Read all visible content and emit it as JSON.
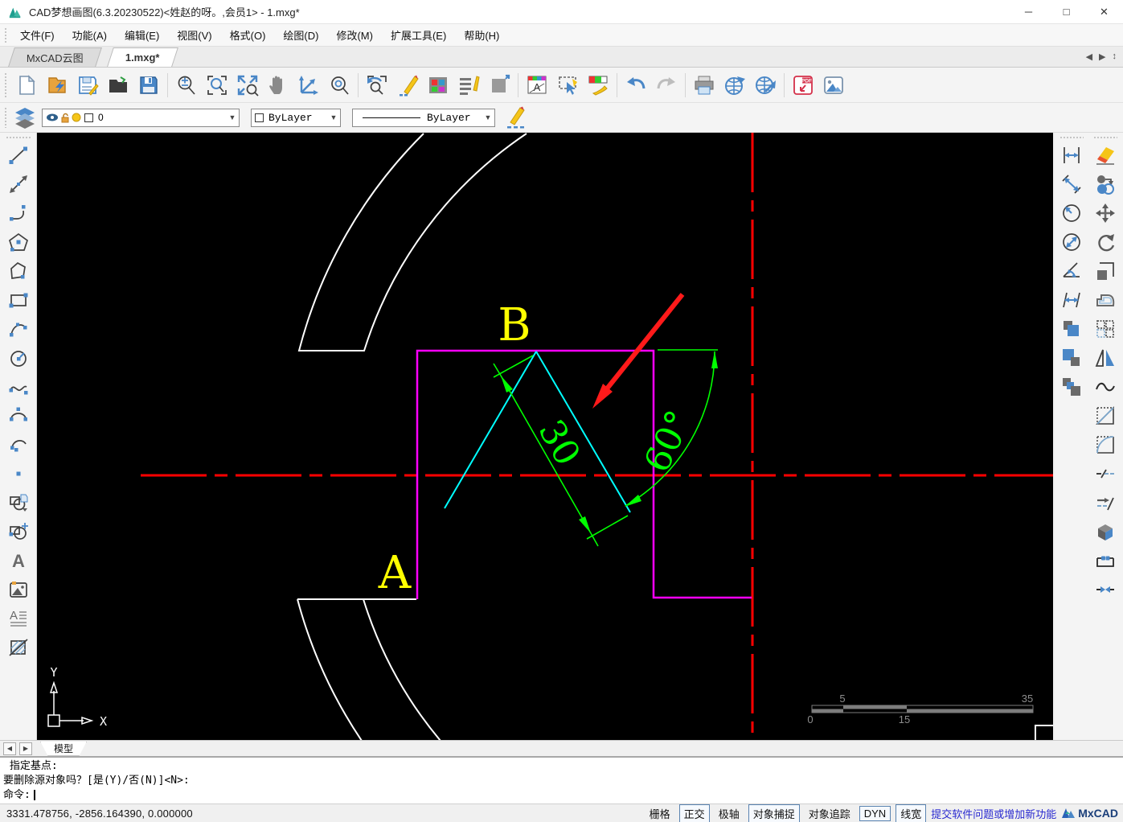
{
  "window": {
    "title": "CAD梦想画图(6.3.20230522)<姓赵的呀。,会员1> - 1.mxg*",
    "controls": {
      "minimize": "─",
      "maximize": "□",
      "close": "✕"
    }
  },
  "menu": {
    "items": [
      "文件(F)",
      "功能(A)",
      "编辑(E)",
      "视图(V)",
      "格式(O)",
      "绘图(D)",
      "修改(M)",
      "扩展工具(E)",
      "帮助(H)"
    ]
  },
  "doc_tabs": {
    "items": [
      {
        "label": "MxCAD云图"
      },
      {
        "label": "1.mxg*"
      }
    ],
    "scrollers": [
      "◀",
      "▶",
      "↕"
    ]
  },
  "toolbar": {
    "icons": [
      "new-file",
      "open-import",
      "save",
      "open-folder",
      "save-as",
      "zoom-scale",
      "zoom-window",
      "zoom-extents",
      "pan",
      "ucs-axes",
      "zoom-center",
      "zoom-previous",
      "sketch-pencil",
      "color-palette",
      "text-style",
      "page-setup",
      "layer-manager",
      "quick-select",
      "match-properties",
      "undo",
      "redo",
      "print",
      "publish-web",
      "web-upload",
      "export-pdf",
      "export-image"
    ]
  },
  "properties_bar": {
    "layer": {
      "value": "0"
    },
    "color": {
      "value": "ByLayer"
    },
    "linetype": {
      "value": "ByLayer"
    }
  },
  "left_toolbar": {
    "icons": [
      "line",
      "construction-line",
      "polyline",
      "polygon-filled",
      "polygon",
      "rectangle",
      "arc",
      "circle",
      "spline",
      "ellipse",
      "ellipse-arc",
      "point",
      "insert-block",
      "create-block",
      "text",
      "image",
      "mtext",
      "hatch"
    ]
  },
  "right_toolbar": {
    "dimension_icons": [
      "dim-linear",
      "dim-aligned",
      "dim-radius",
      "dim-diameter",
      "dim-angular",
      "dim-continue",
      "copy-squares",
      "scale-squares",
      "stretch-squares"
    ],
    "modify_icons": [
      "erase",
      "copy",
      "move",
      "rotate",
      "stretch",
      "offset",
      "array",
      "mirror",
      "spline-curve",
      "chamfer",
      "fillet",
      "break",
      "break-at-point",
      "explode",
      "pedit",
      "join"
    ]
  },
  "drawing": {
    "point_labels": {
      "a": "A",
      "b": "B"
    },
    "dim_length": "30",
    "dim_angle": "60°",
    "ucs": {
      "x_label": "X",
      "y_label": "Y"
    },
    "scale_bar": {
      "top_labels": [
        "5",
        "35"
      ],
      "bottom_labels": [
        "0",
        "15"
      ]
    },
    "colors": {
      "outline": "#ffffff",
      "slot": "#ff00ff",
      "construction": "#00ffff",
      "dimension": "#00ff00",
      "centerline": "#ff0000",
      "label": "#ffff00",
      "annotation_arrow": "#ff1a1a"
    }
  },
  "model_bar": {
    "prev": "◀",
    "next": "▶",
    "tab_label": "模型"
  },
  "command_line": {
    "history": [
      " 指定基点:",
      "要删除源对象吗？[是(Y)/否(N)]<N>:"
    ],
    "prompt": "命令:"
  },
  "status_bar": {
    "coordinates": "3331.478756,  -2856.164390,  0.000000",
    "toggles": [
      {
        "label": "栅格",
        "active": false
      },
      {
        "label": "正交",
        "active": true
      },
      {
        "label": "极轴",
        "active": false
      },
      {
        "label": "对象捕捉",
        "active": true
      },
      {
        "label": "对象追踪",
        "active": false
      },
      {
        "label": "DYN",
        "active": true
      },
      {
        "label": "线宽",
        "active": true
      }
    ],
    "feedback_link": "提交软件问题或增加新功能",
    "brand": "MxCAD"
  }
}
